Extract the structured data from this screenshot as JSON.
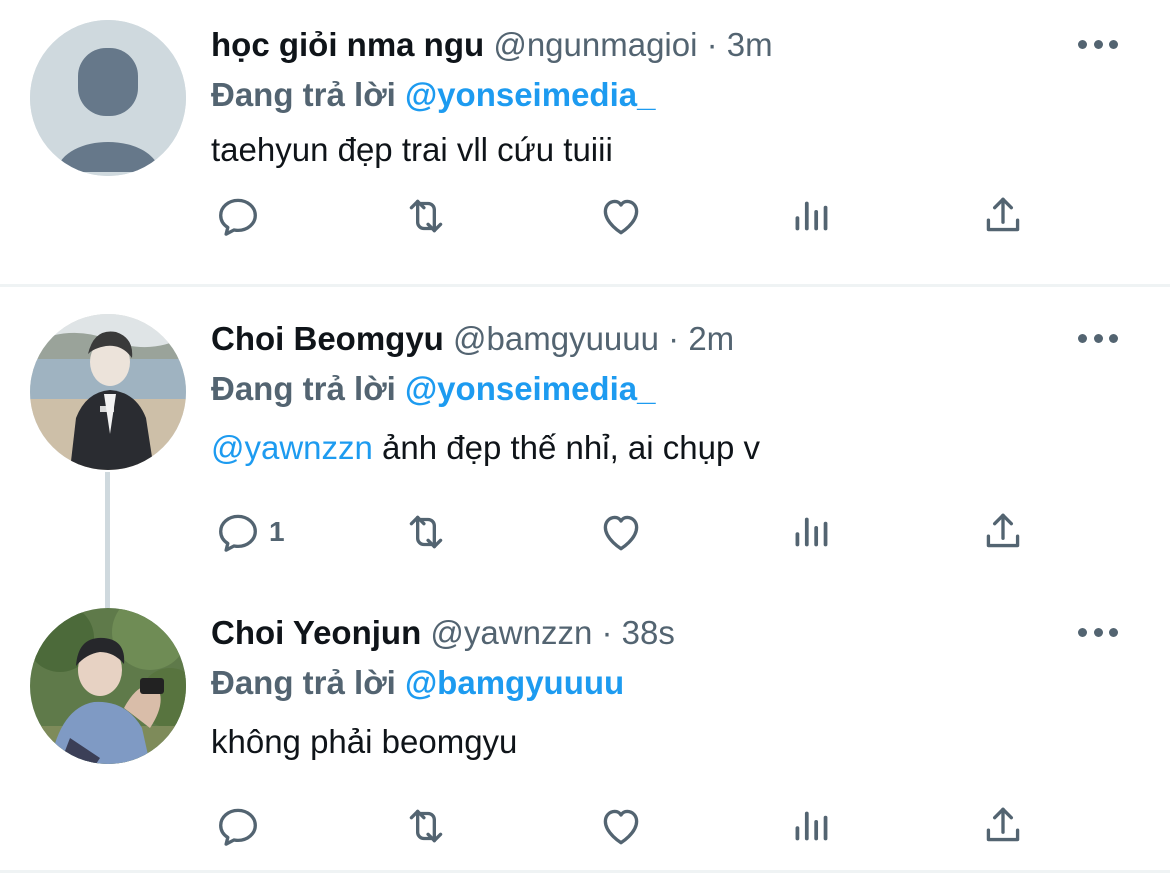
{
  "tweets": [
    {
      "name": "học giỏi nma ngu",
      "handle": "@ngunmagioi",
      "separator": "·",
      "time": "3m",
      "reply_prefix": "Đang trả lời",
      "reply_to": "@yonseimedia_",
      "text_mention": "",
      "text": "taehyun đẹp trai vll cứu tuiii",
      "reply_count": ""
    },
    {
      "name": "Choi Beomgyu",
      "handle": "@bamgyuuuu",
      "separator": "·",
      "time": "2m",
      "reply_prefix": "Đang trả lời",
      "reply_to": "@yonseimedia_",
      "text_mention": "@yawnzzn",
      "text": " ảnh đẹp thế nhỉ, ai chụp v",
      "reply_count": "1"
    },
    {
      "name": "Choi Yeonjun",
      "handle": "@yawnzzn",
      "separator": "·",
      "time": "38s",
      "reply_prefix": "Đang trả lời",
      "reply_to": "@bamgyuuuu",
      "text_mention": "",
      "text": "không phải beomgyu",
      "reply_count": ""
    }
  ],
  "icons": {
    "reply": "reply-icon",
    "retweet": "retweet-icon",
    "like": "heart-icon",
    "analytics": "analytics-icon",
    "share": "share-icon",
    "more": "more-icon"
  },
  "colors": {
    "accent": "#1d9bf0",
    "secondary_text": "#536471",
    "primary_text": "#0f1419",
    "divider": "#eff3f4",
    "avatar_placeholder": "#cfd9de"
  }
}
